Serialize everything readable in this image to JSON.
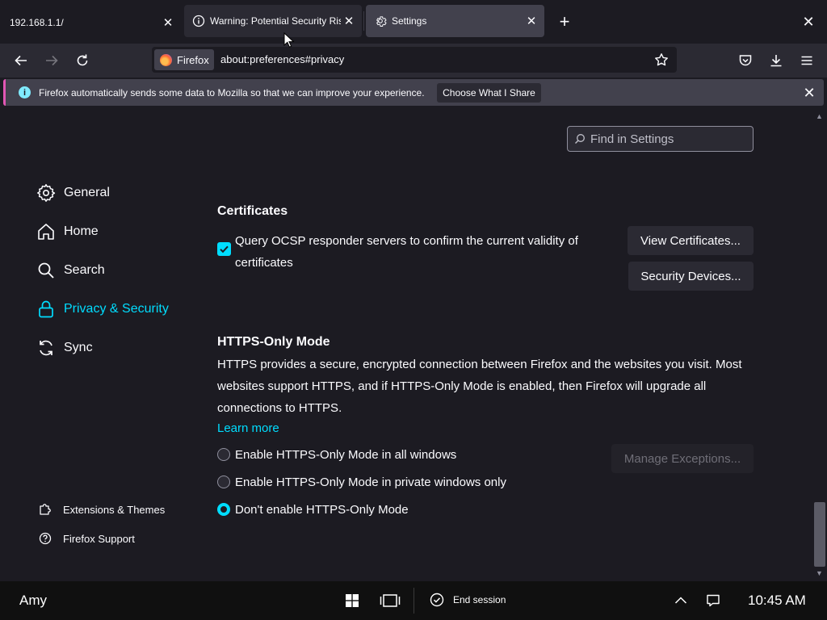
{
  "tabs": [
    {
      "title": "192.168.1.1/",
      "close": "✕"
    },
    {
      "title": "Warning: Potential Security Risk Ahead",
      "close": "✕"
    },
    {
      "title": "Settings",
      "close": "✕"
    }
  ],
  "tabstrip": {
    "new_tab": "+",
    "close_window": "✕"
  },
  "navbar": {
    "identity_label": "Firefox",
    "url": "about:preferences#privacy"
  },
  "notification": {
    "message": "Firefox automatically sends some data to Mozilla so that we can improve your experience.",
    "button": "Choose What I Share",
    "close": "✕"
  },
  "search": {
    "placeholder": "Find in Settings"
  },
  "sidebar": {
    "items": [
      {
        "label": "General",
        "icon": "gear-icon"
      },
      {
        "label": "Home",
        "icon": "home-icon"
      },
      {
        "label": "Search",
        "icon": "search-icon"
      },
      {
        "label": "Privacy & Security",
        "icon": "lock-icon",
        "active": true
      },
      {
        "label": "Sync",
        "icon": "sync-icon"
      }
    ],
    "footer": [
      {
        "label": "Extensions & Themes",
        "icon": "puzzle-icon"
      },
      {
        "label": "Firefox Support",
        "icon": "help-icon"
      }
    ]
  },
  "certificates": {
    "title": "Certificates",
    "ocsp_label": "Query OCSP responder servers to confirm the current validity of certificates",
    "ocsp_checked": true,
    "view_button": "View Certificates...",
    "devices_button": "Security Devices..."
  },
  "https_only": {
    "title": "HTTPS-Only Mode",
    "description": "HTTPS provides a secure, encrypted connection between Firefox and the websites you visit. Most websites support HTTPS, and if HTTPS-Only Mode is enabled, then Firefox will upgrade all connections to HTTPS.",
    "learn_more": "Learn more",
    "options": [
      {
        "label": "Enable HTTPS-Only Mode in all windows",
        "checked": false
      },
      {
        "label": "Enable HTTPS-Only Mode in private windows only",
        "checked": false
      },
      {
        "label": "Don't enable HTTPS-Only Mode",
        "checked": true
      }
    ],
    "manage_button": "Manage Exceptions..."
  },
  "taskbar": {
    "user": "Amy",
    "end_session": "End session",
    "time": "10:45 AM"
  },
  "colors": {
    "accent": "#00ddff",
    "background": "#1c1b22",
    "toolbar": "#2b2a33",
    "notification_accent": "#e256b4"
  }
}
